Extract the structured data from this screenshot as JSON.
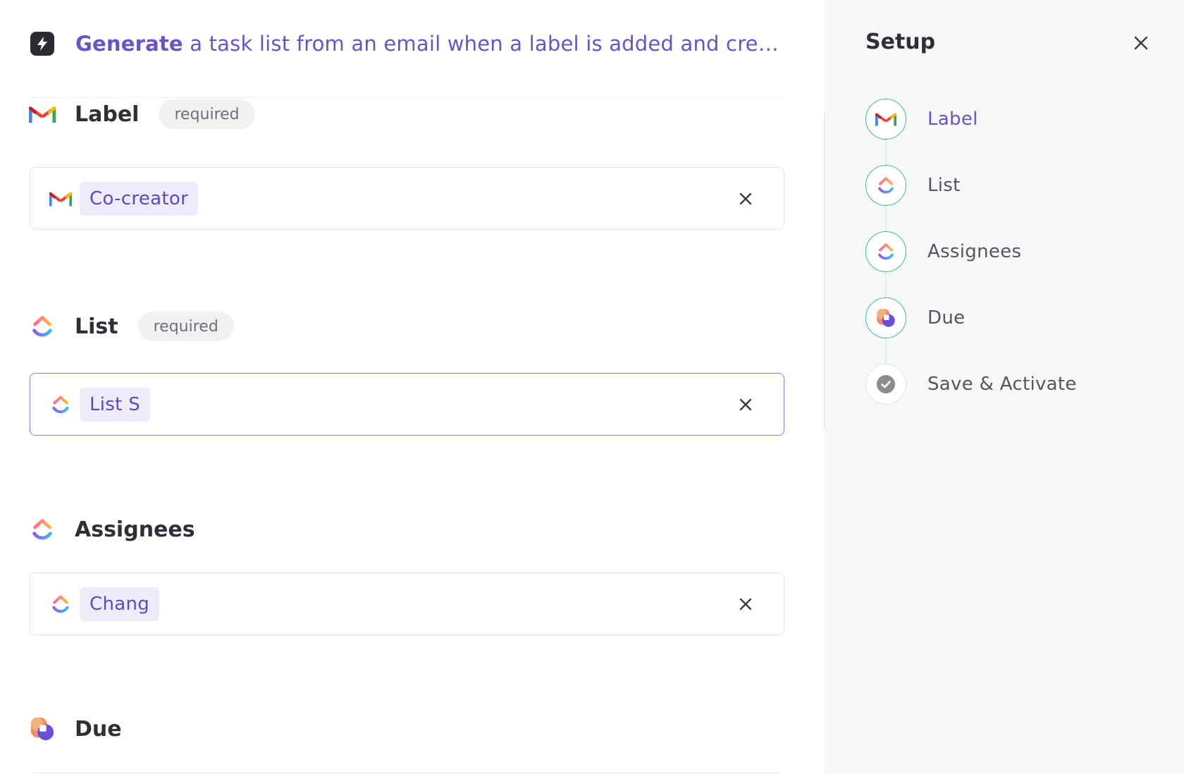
{
  "header": {
    "verb": "Generate",
    "description": " a task list from an email when a label is added and create a ..."
  },
  "fields": {
    "label": {
      "title": "Label",
      "badge": "required",
      "value": "Co-creator"
    },
    "list": {
      "title": "List",
      "badge": "required",
      "value": "List S"
    },
    "assignees": {
      "title": "Assignees",
      "value": "Chang"
    },
    "due": {
      "title": "Due"
    }
  },
  "setup": {
    "title": "Setup",
    "steps": [
      {
        "label": "Label",
        "icon": "gmail-icon",
        "state": "active"
      },
      {
        "label": "List",
        "icon": "clickup-icon",
        "state": "done"
      },
      {
        "label": "Assignees",
        "icon": "clickup-icon",
        "state": "done"
      },
      {
        "label": "Due",
        "icon": "due-app-icon",
        "state": "done"
      },
      {
        "label": "Save & Activate",
        "icon": "check-circle-icon",
        "state": "pending"
      }
    ]
  },
  "colors": {
    "accent": "#6a52c9",
    "chip_bg": "#eeebfa",
    "step_ring": "#3fbf8f",
    "panel_bg": "#f7f8fa"
  }
}
